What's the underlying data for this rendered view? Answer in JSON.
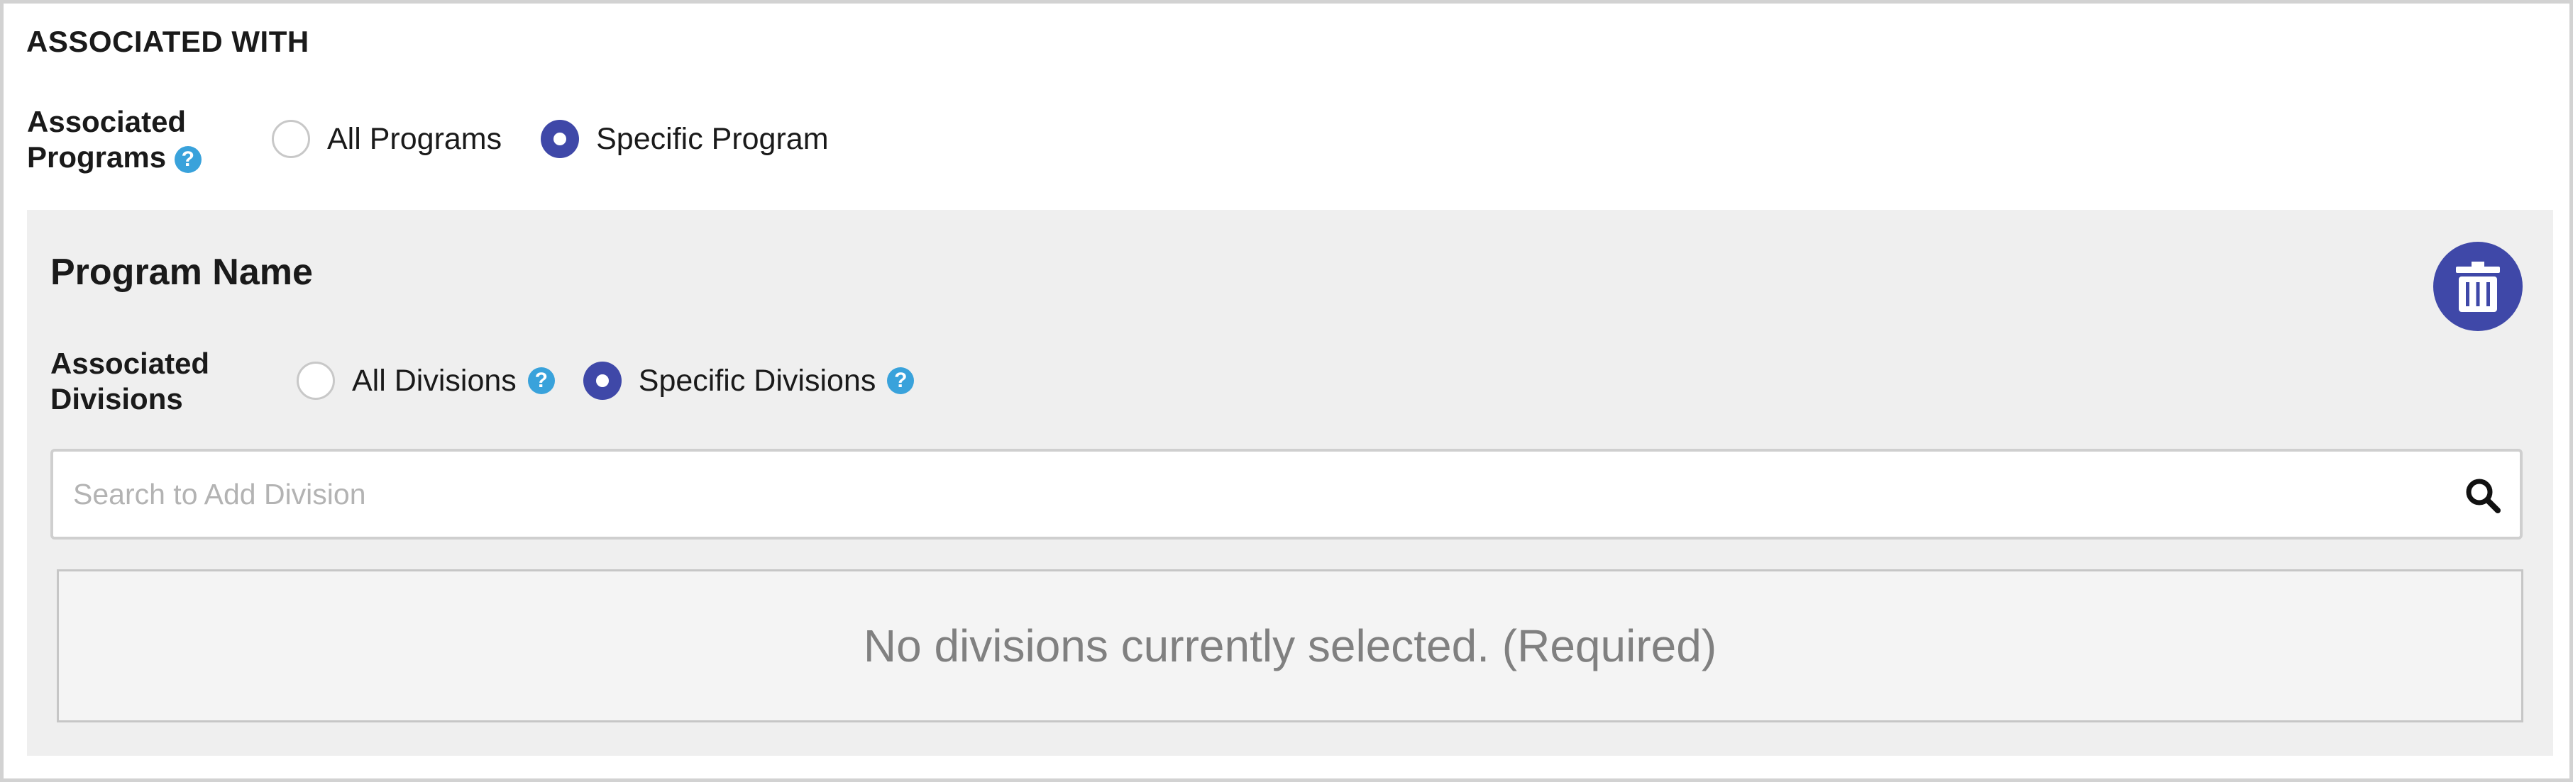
{
  "section": {
    "title": "ASSOCIATED WITH"
  },
  "associated_programs": {
    "label_line1": "Associated",
    "label_line2": "Programs",
    "help": "?",
    "options": [
      {
        "label": "All Programs",
        "selected": false
      },
      {
        "label": "Specific Program",
        "selected": true
      }
    ]
  },
  "program": {
    "name": "Program Name",
    "delete_icon": "trash-icon",
    "associated_divisions": {
      "label_line1": "Associated",
      "label_line2": "Divisions",
      "options": [
        {
          "label": "All Divisions",
          "selected": false,
          "help": "?"
        },
        {
          "label": "Specific Divisions",
          "selected": true,
          "help": "?"
        }
      ]
    },
    "search": {
      "placeholder": "Search to Add Division",
      "value": "",
      "icon": "search-icon"
    },
    "empty_message": "No divisions currently selected. (Required)"
  },
  "colors": {
    "accent": "#3f48a8",
    "help": "#39a2db",
    "panel_bg": "#efefef",
    "empty_text": "#808080"
  }
}
